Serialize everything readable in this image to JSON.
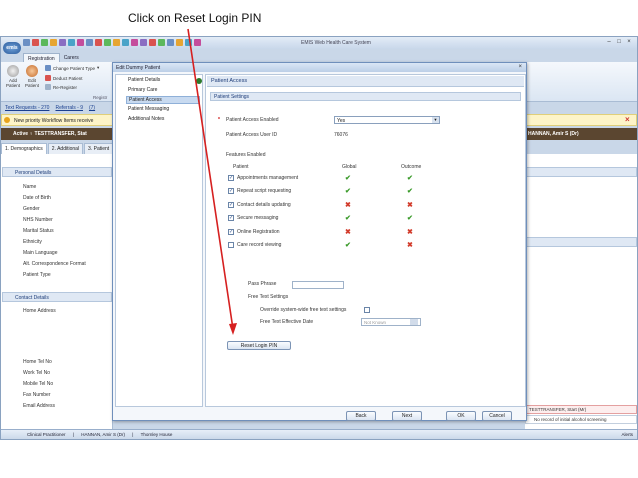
{
  "caption": "Click on Reset Login PIN",
  "app": {
    "title": "EMIS Web Health Care System",
    "logo": "emis",
    "ribbon_tabs": [
      "Registration",
      "Carers"
    ],
    "ribbon": {
      "add_patient": "Add Patient",
      "edit_patient": "Edit Patient",
      "change_patient_type": "Change Patient Type",
      "deduct_patient": "Deduct Patient",
      "re_register": "Re-Register",
      "group_label": "Registr"
    },
    "links": [
      "Text Requests - 270",
      "Referrals - 9",
      "(7)"
    ],
    "workflow_text": "New priority Workflow Items receive",
    "patient_bar": "Active   ♀  TESTTRANSFER, Stat",
    "patient_bar_right": "HANNAN, Amir S (Dr)",
    "patient_tabs": [
      "1. Demographics",
      "2. Additional",
      "3. Patient"
    ],
    "sections": {
      "personal": "Personal Details",
      "contact": "Contact Details"
    },
    "personal_fields": [
      "Name",
      "Date of Birth",
      "Gender",
      "NHS Number",
      "Marital Status",
      "Ethnicity",
      "Main Language",
      "Alt. Correspondence Format",
      "Patient Type"
    ],
    "contact_fields": [
      "Home Address",
      "Home Tel No",
      "Work Tel No",
      "Mobile Tel No",
      "Fax Number",
      "Email Address"
    ],
    "alert_row": "TESTTRANSFER, Start (Mr)",
    "alert_row2": "No record of initial alcohol screening",
    "status": {
      "role": "Clinical Practitioner",
      "user": "HANNAN, Amir S (Dr)",
      "practice": "Thornley House",
      "alerts": "Alerts"
    }
  },
  "dialog": {
    "title": "Edit Dummy Patient",
    "nav": [
      "Patient Details",
      "Primary Care",
      "Patient Access",
      "Patient Messaging",
      "Additional Notes"
    ],
    "nav_selected": "Patient Access",
    "header": "Patient Access",
    "section": "Patient Settings",
    "enabled_label": "Patient Access Enabled",
    "enabled_value": "Yes",
    "user_id_label": "Patient Access User ID",
    "user_id_value": "76076",
    "features_label": "Features Enabled",
    "col_patient": "Patient",
    "col_global": "Global",
    "col_outcome": "Outcome",
    "features": [
      {
        "name": "Appointments management",
        "checked": true,
        "global": "tick",
        "outcome": "tick"
      },
      {
        "name": "Repeat script requesting",
        "checked": true,
        "global": "tick",
        "outcome": "tick"
      },
      {
        "name": "Contact details updating",
        "checked": true,
        "global": "cross",
        "outcome": "cross"
      },
      {
        "name": "Secure messaging",
        "checked": true,
        "global": "tick",
        "outcome": "tick"
      },
      {
        "name": "Online Registration",
        "checked": true,
        "global": "cross",
        "outcome": "cross"
      },
      {
        "name": "Care record viewing",
        "checked": false,
        "global": "tick",
        "outcome": "cross"
      }
    ],
    "pass_phrase": "Pass Phrase",
    "free_text_settings": "Free Text Settings",
    "override_label": "Override system-wide free text settings",
    "effective_date_label": "Free Text Effective Date",
    "effective_date_placeholder": "Not Known",
    "reset_button": "Reset Login PIN",
    "buttons": {
      "back": "Back",
      "next": "Next",
      "ok": "OK",
      "cancel": "Cancel"
    }
  },
  "colors": {
    "tick": "#3a9a2a",
    "cross": "#d23b2b",
    "arrow": "#d62020"
  }
}
